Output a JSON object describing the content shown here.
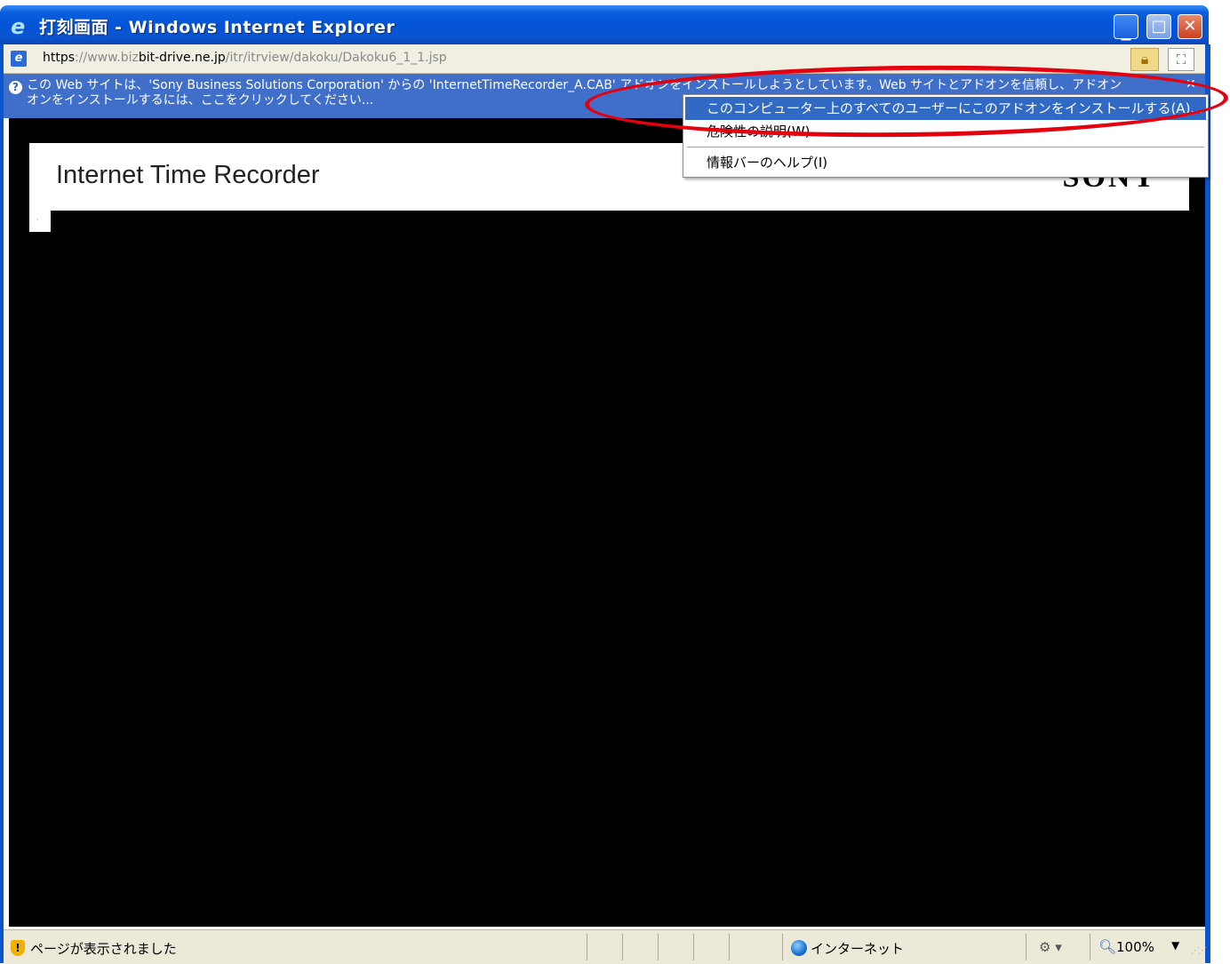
{
  "window": {
    "title": "打刻画面 - Windows Internet Explorer",
    "min_label": "_",
    "max_label": "□",
    "close_label": "✕"
  },
  "address": {
    "url_part1": "https",
    "url_part2": "://www.biz",
    "url_part3": "bit-drive.ne.jp",
    "url_part4": "/itr/itrview/dakoku/Dakoku6_1_1.jsp"
  },
  "infobar": {
    "line1": "この Web サイトは、'Sony Business Solutions Corporation' からの 'InternetTimeRecorder_A.CAB' アドオンをインストールしようとしています。Web サイトとアドオンを信頼し、アドオン",
    "line2": "オンをインストールするには、ここをクリックしてください...",
    "close": "✕"
  },
  "context_menu": {
    "items": [
      "このコンピューター上のすべてのユーザーにこのアドオンをインストールする(A)...",
      "危険性の説明(W)",
      "情報バーのヘルプ(I)"
    ]
  },
  "page": {
    "app_title": "Internet Time Recorder",
    "logo": "SONY"
  },
  "status": {
    "text": "ページが表示されました",
    "zone": "インターネット",
    "zoom": "100%"
  },
  "icons": [
    "ie-logo-icon",
    "page-icon",
    "lock-icon",
    "compat-view-icon",
    "help-icon",
    "shield-icon",
    "globe-icon",
    "protected-mode-icon",
    "zoom-icon"
  ],
  "colors": {
    "title_bar": "#0454d6",
    "info_bar": "#3f6fc9",
    "menu_highlight": "#316ac5",
    "annotation": "#e3000f"
  }
}
